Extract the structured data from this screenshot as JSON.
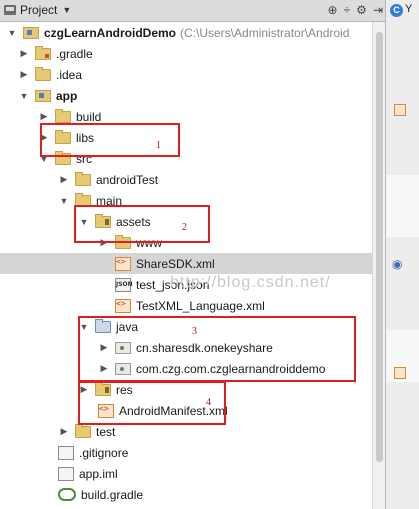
{
  "header": {
    "title": "Project",
    "icons": [
      "target-icon",
      "collapse-icon",
      "settings-icon",
      "hide-icon"
    ]
  },
  "tree": {
    "root_label": "czgLearnAndroidDemo",
    "root_path": "(C:\\Users\\Administrator\\Android",
    "gradle": ".gradle",
    "idea": ".idea",
    "app": "app",
    "build": "build",
    "libs": "libs",
    "src": "src",
    "androidTest": "androidTest",
    "main": "main",
    "assets": "assets",
    "www": "www",
    "sharesdk_xml": "ShareSDK.xml",
    "test_json": "test_json.json",
    "testxml": "TestXML_Language.xml",
    "java": "java",
    "pkg1": "cn.sharesdk.onekeyshare",
    "pkg2": "com.czg.com.czglearnandroiddemo",
    "res": "res",
    "manifest": "AndroidManifest.xml",
    "test": "test",
    "gitignore": ".gitignore",
    "app_iml": "app.iml",
    "build_gradle": "build.gradle",
    "json_badge": "JSON"
  },
  "annotations": {
    "n1": "1",
    "n2": "2",
    "n3": "3",
    "n4": "4",
    "color": "#e01e1e"
  },
  "watermark": "http://blog.csdn.net/",
  "side": {
    "tab_letter": "C",
    "tab_text": "Y"
  }
}
